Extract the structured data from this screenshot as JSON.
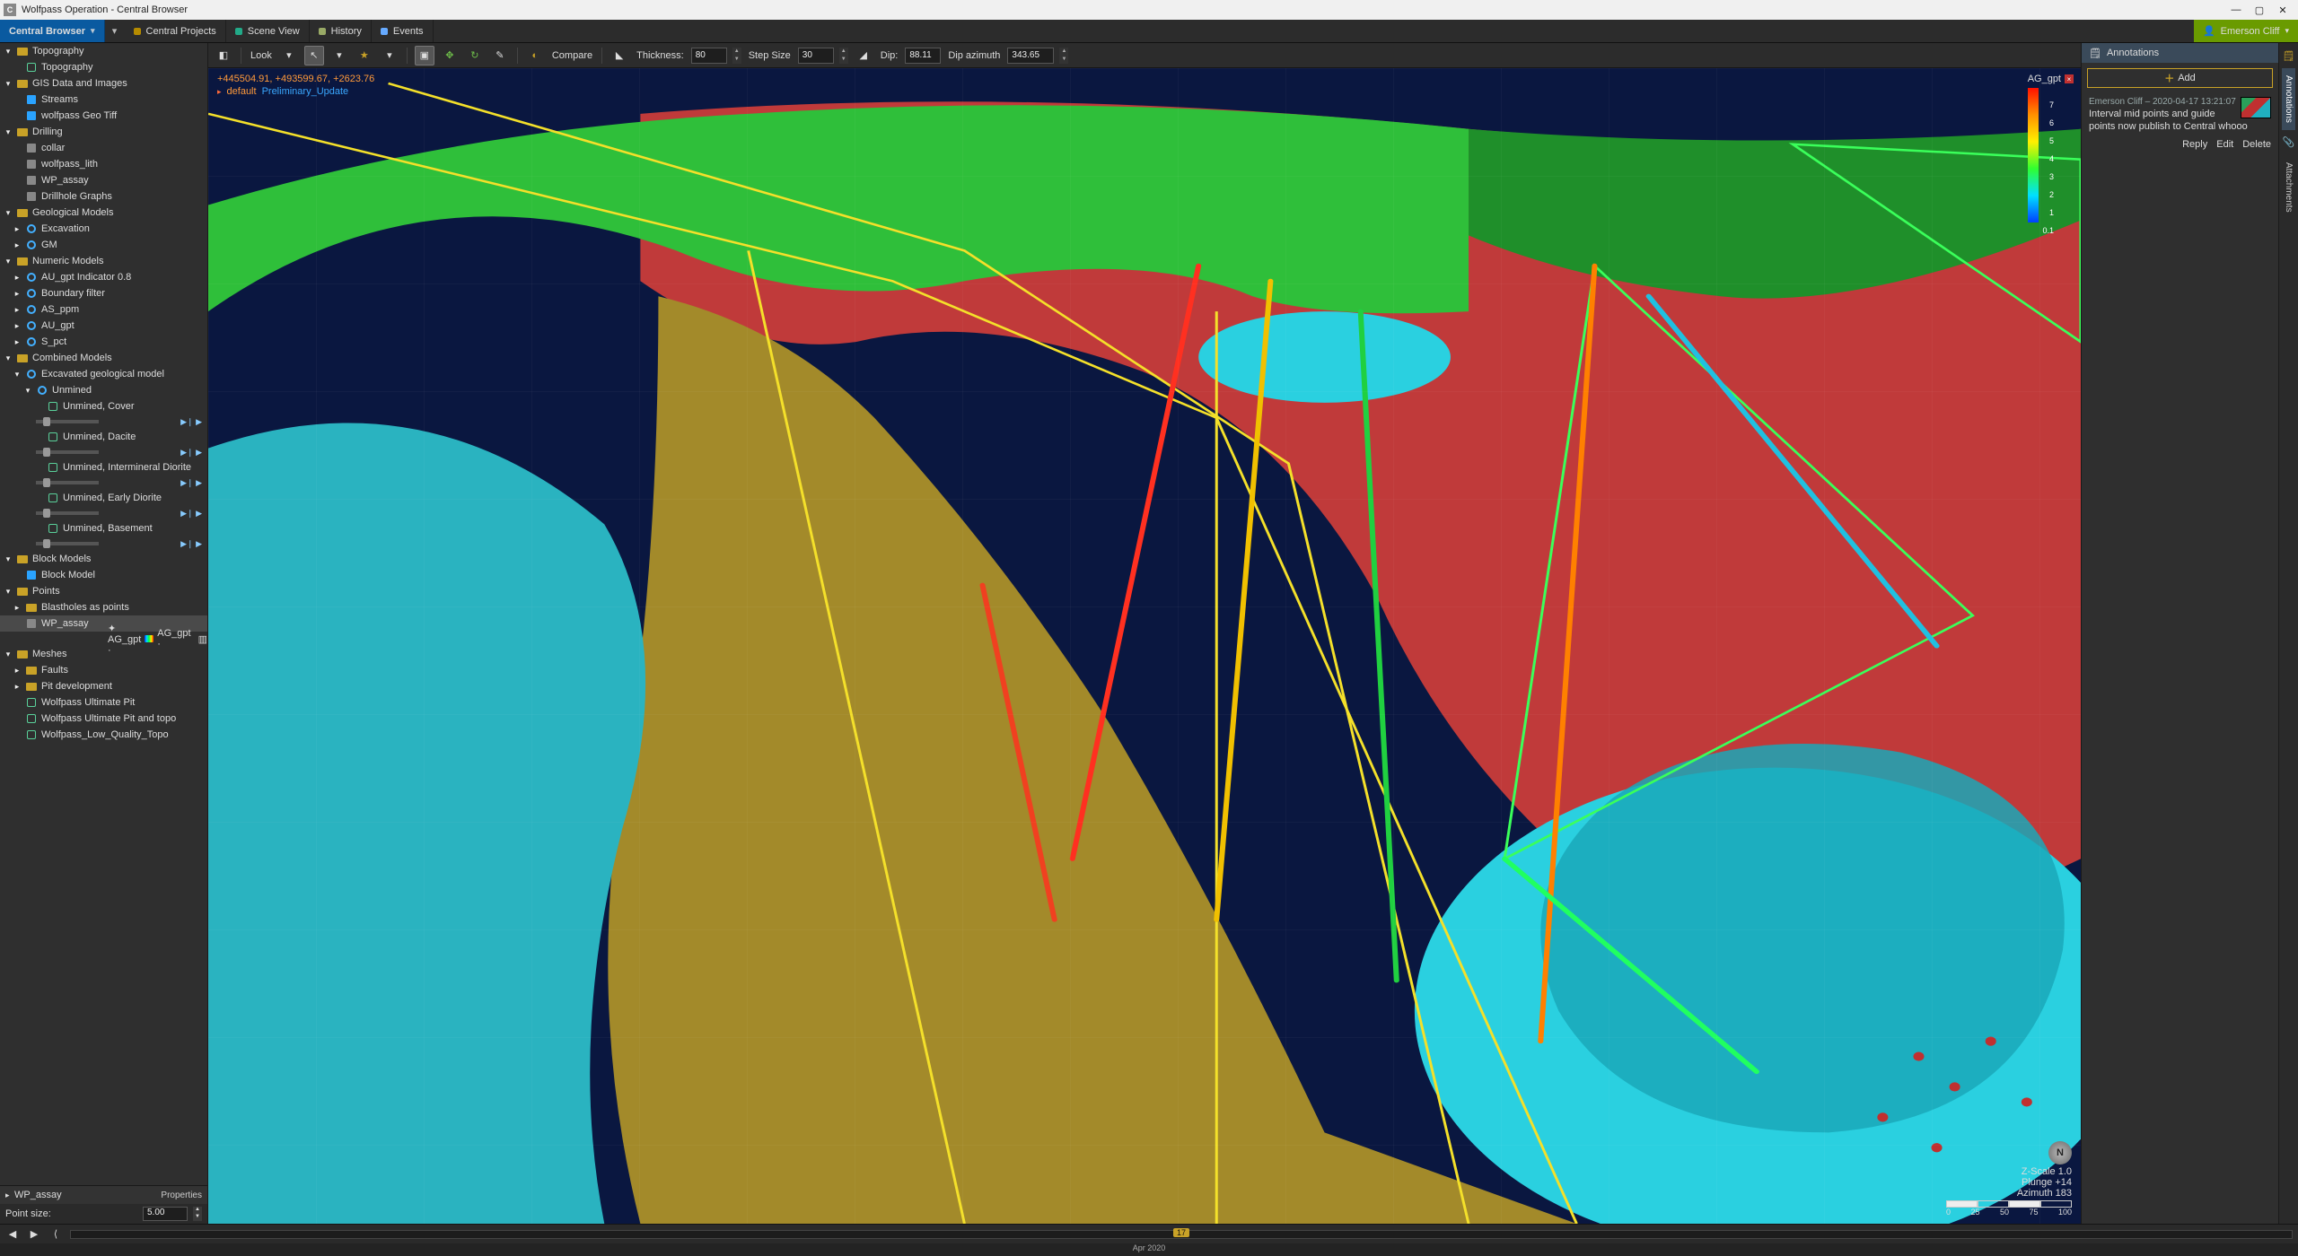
{
  "window": {
    "title": "Wolfpass Operation - Central Browser",
    "app_badge": "C"
  },
  "ribbon": {
    "main_tab": "Central Browser",
    "tabs": [
      {
        "label": "Central Projects",
        "kind": "proj"
      },
      {
        "label": "Scene View",
        "kind": "scene"
      },
      {
        "label": "History",
        "kind": "hist"
      },
      {
        "label": "Events",
        "kind": "ev"
      }
    ],
    "user": "Emerson Cliff"
  },
  "toolbar": {
    "look": "Look",
    "compare": "Compare",
    "thickness_label": "Thickness:",
    "thickness": "80",
    "step_label": "Step Size",
    "step": "30",
    "dip_label": "Dip:",
    "dip": "88.11",
    "azimuth_label": "Dip azimuth",
    "azimuth": "343.65"
  },
  "viewport": {
    "coords": "+445504.91, +493599.67, +2623.76",
    "default_label": "default",
    "status_label": "Preliminary_Update",
    "legend_title": "AG_gpt",
    "legend_ticks": [
      "7",
      "6",
      "5",
      "4",
      "3",
      "2",
      "1",
      "0.1"
    ],
    "zscale": "Z-Scale 1.0",
    "plunge": "Plunge +14",
    "azimuth": "Azimuth 183",
    "scale_ticks": [
      "0",
      "25",
      "50",
      "75",
      "100"
    ]
  },
  "tree": {
    "items": [
      {
        "d": 0,
        "exp": "▾",
        "ico": "folder",
        "label": "Topography"
      },
      {
        "d": 1,
        "exp": "",
        "ico": "mesh",
        "label": "Topography"
      },
      {
        "d": 0,
        "exp": "▾",
        "ico": "folder",
        "label": "GIS Data and Images"
      },
      {
        "d": 1,
        "exp": "",
        "ico": "cube",
        "label": "Streams"
      },
      {
        "d": 1,
        "exp": "",
        "ico": "cube",
        "label": "wolfpass Geo Tiff"
      },
      {
        "d": 0,
        "exp": "▾",
        "ico": "folder",
        "label": "Drilling"
      },
      {
        "d": 1,
        "exp": "",
        "ico": "sq",
        "label": "collar"
      },
      {
        "d": 1,
        "exp": "",
        "ico": "sq",
        "label": "wolfpass_lith"
      },
      {
        "d": 1,
        "exp": "",
        "ico": "sq",
        "label": "WP_assay"
      },
      {
        "d": 1,
        "exp": "",
        "ico": "sq",
        "label": "Drillhole Graphs"
      },
      {
        "d": 0,
        "exp": "▾",
        "ico": "folder",
        "label": "Geological Models"
      },
      {
        "d": 1,
        "exp": "▸",
        "ico": "ring",
        "label": "Excavation"
      },
      {
        "d": 1,
        "exp": "▸",
        "ico": "ring",
        "label": "GM"
      },
      {
        "d": 0,
        "exp": "▾",
        "ico": "folder",
        "label": "Numeric Models"
      },
      {
        "d": 1,
        "exp": "▸",
        "ico": "ring",
        "label": "AU_gpt Indicator 0.8"
      },
      {
        "d": 1,
        "exp": "▸",
        "ico": "ring",
        "label": "Boundary filter"
      },
      {
        "d": 1,
        "exp": "▸",
        "ico": "ring",
        "label": "AS_ppm"
      },
      {
        "d": 1,
        "exp": "▸",
        "ico": "ring",
        "label": "AU_gpt"
      },
      {
        "d": 1,
        "exp": "▸",
        "ico": "ring",
        "label": "S_pct"
      },
      {
        "d": 0,
        "exp": "▾",
        "ico": "folder",
        "label": "Combined Models"
      },
      {
        "d": 1,
        "exp": "▾",
        "ico": "ring",
        "label": "Excavated geological model"
      },
      {
        "d": 2,
        "exp": "▾",
        "ico": "ring",
        "label": "Unmined"
      },
      {
        "d": 3,
        "exp": "",
        "ico": "mesh",
        "label": "Unmined, Cover",
        "slider": true
      },
      {
        "d": 3,
        "exp": "",
        "ico": "mesh",
        "label": "Unmined, Dacite",
        "slider": true
      },
      {
        "d": 3,
        "exp": "",
        "ico": "mesh",
        "label": "Unmined, Intermineral Diorite",
        "slider": true
      },
      {
        "d": 3,
        "exp": "",
        "ico": "mesh",
        "label": "Unmined, Early Diorite",
        "slider": true
      },
      {
        "d": 3,
        "exp": "",
        "ico": "mesh",
        "label": "Unmined, Basement",
        "slider": true
      },
      {
        "d": 0,
        "exp": "▾",
        "ico": "folder",
        "label": "Block Models"
      },
      {
        "d": 1,
        "exp": "",
        "ico": "cube",
        "label": "Block Model"
      },
      {
        "d": 0,
        "exp": "▾",
        "ico": "folder",
        "label": "Points"
      },
      {
        "d": 1,
        "exp": "▸",
        "ico": "folder",
        "label": "Blastholes as points"
      },
      {
        "d": 1,
        "exp": "",
        "ico": "sq",
        "label": "WP_assay",
        "sel": true,
        "legend": true
      },
      {
        "d": 0,
        "exp": "▾",
        "ico": "folder",
        "label": "Meshes"
      },
      {
        "d": 1,
        "exp": "▸",
        "ico": "folder",
        "label": "Faults"
      },
      {
        "d": 1,
        "exp": "▸",
        "ico": "folder",
        "label": "Pit development"
      },
      {
        "d": 1,
        "exp": "",
        "ico": "mesh",
        "label": "Wolfpass Ultimate Pit"
      },
      {
        "d": 1,
        "exp": "",
        "ico": "mesh",
        "label": "Wolfpass Ultimate Pit and topo"
      },
      {
        "d": 1,
        "exp": "",
        "ico": "mesh",
        "label": "Wolfpass_Low_Quality_Topo"
      }
    ],
    "legend_a": "AG_gpt",
    "legend_b": "AG_gpt"
  },
  "properties": {
    "title": "WP_assay",
    "heading": "Properties",
    "pointsize_label": "Point size:",
    "pointsize": "5.00"
  },
  "annotations": {
    "title": "Annotations",
    "add": "Add",
    "note_meta": "Emerson Cliff – 2020-04-17 13:21:07",
    "note_body": "Interval mid points and guide points now publish to Central whooo",
    "actions": {
      "reply": "Reply",
      "edit": "Edit",
      "delete": "Delete"
    },
    "side_tabs": {
      "annotations": "Annotations",
      "attachments": "Attachments"
    }
  },
  "timeline": {
    "marker": "17",
    "label": "Apr 2020"
  }
}
